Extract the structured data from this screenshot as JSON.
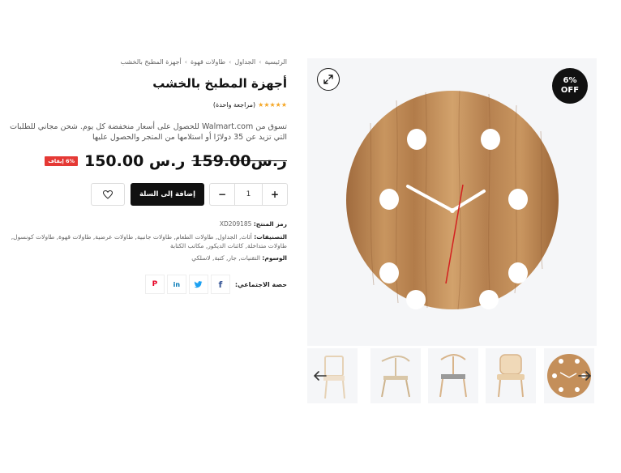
{
  "breadcrumb": {
    "items": [
      "الرئيسية",
      "الجداول",
      "طاولات قهوة",
      "أجهزة المطبخ بالخشب"
    ],
    "separator": "›"
  },
  "product": {
    "title": "أجهزة المطبخ بالخشب",
    "rating": {
      "stars": 5,
      "label": "(مراجعة واحدة)"
    },
    "description": "تسوق من Walmart.com للحصول على أسعار منخفضة كل يوم. شحن مجاني للطلبات التي تزيد عن 35 دولارًا أو استلامها من المتجر والحصول عليها",
    "old_price": "159.00ر.س",
    "new_price": "150.00 ر.س",
    "discount_tag": "6% إيقاف",
    "image_badge": {
      "line1": "6%",
      "line2": "OFF"
    }
  },
  "cart": {
    "quantity": "1",
    "minus": "−",
    "plus": "+",
    "add_label": "إضافة إلى السلة"
  },
  "meta": {
    "sku_label": "رمز المنتج:",
    "sku": "XD209185",
    "categories_label": "التصنيفات:",
    "categories": "أثاث, الجداول, طاولات الطعام, طاولات جانبية, طاولات عرضية, طاولات قهوة, طاولات كونسول, طاولات متداخلة, كائنات الديكور, مكاتب الكتابة",
    "tags_label": "الوسوم:",
    "tags": "التقنيات, جار, كتبة, لاسلكي"
  },
  "share": {
    "label": "حصة الاجتماعي:",
    "networks": [
      {
        "name": "facebook",
        "glyph": "f",
        "color": "#3b5998"
      },
      {
        "name": "twitter",
        "glyph": "t",
        "color": "#1da1f2"
      },
      {
        "name": "linkedin",
        "glyph": "in",
        "color": "#0077b5"
      },
      {
        "name": "pinterest",
        "glyph": "P",
        "color": "#e60023"
      }
    ]
  },
  "gallery": {
    "zoom_icon": "expand-icon",
    "thumbnails": [
      "wooden-chair",
      "wishbone-chair",
      "cord-seat-chair",
      "cane-armchair",
      "wooden-clock"
    ],
    "nav_prev_icon": "arrow-left-icon",
    "nav_next_icon": "arrow-right-icon"
  },
  "colors": {
    "accent_dark": "#111111",
    "sale_red": "#e53935",
    "star": "#f5a623",
    "gallery_bg": "#f5f6f8"
  }
}
